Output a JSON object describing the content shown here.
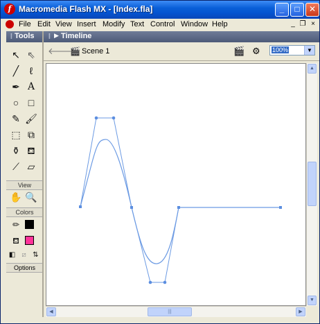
{
  "window": {
    "title": "Macromedia Flash MX - [Index.fla]"
  },
  "title_buttons": {
    "minimize": "_",
    "maximize": "□",
    "close": "✕"
  },
  "menu": [
    {
      "label": "File"
    },
    {
      "label": "Edit"
    },
    {
      "label": "View"
    },
    {
      "label": "Insert"
    },
    {
      "label": "Modify"
    },
    {
      "label": "Text"
    },
    {
      "label": "Control"
    },
    {
      "label": "Window"
    },
    {
      "label": "Help"
    }
  ],
  "mdi_buttons": {
    "minimize": "_",
    "restore": "❐",
    "close": "×"
  },
  "tools_panel": {
    "title": "Tools",
    "sections": {
      "view": "View",
      "colors": "Colors",
      "options": "Options"
    },
    "icons": [
      "arrow-tool-icon",
      "subselect-tool-icon",
      "line-tool-icon",
      "lasso-tool-icon",
      "pen-tool-icon",
      "text-tool-icon",
      "oval-tool-icon",
      "rectangle-tool-icon",
      "pencil-tool-icon",
      "brush-tool-icon",
      "free-transform-tool-icon",
      "fill-transform-tool-icon",
      "ink-bottle-tool-icon",
      "paint-bucket-tool-icon",
      "eyedropper-tool-icon",
      "eraser-tool-icon",
      "hand-tool-icon",
      "zoom-tool-icon"
    ],
    "stroke_color": "#000000",
    "fill_color": "#ff3399"
  },
  "timeline": {
    "title": "Timeline"
  },
  "editbar": {
    "scene": "Scene 1",
    "zoom": "100%"
  },
  "stage": {
    "background": "#ffffff",
    "stroke_color": "#6b9ae3",
    "handle_color": "#5b8ee0"
  }
}
